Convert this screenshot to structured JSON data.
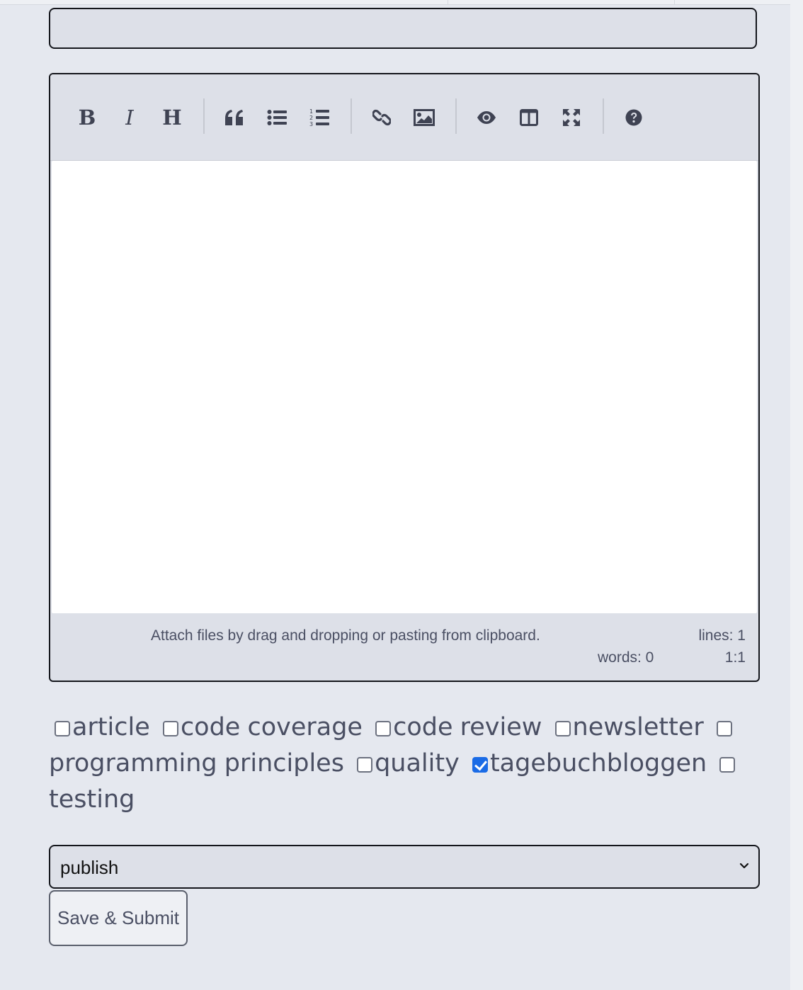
{
  "form": {
    "title_value": "",
    "title_placeholder": ""
  },
  "editor": {
    "toolbar": [
      {
        "name": "bold-icon",
        "glyph": "B"
      },
      {
        "name": "italic-icon",
        "glyph": "I"
      },
      {
        "name": "heading-icon",
        "glyph": "H"
      },
      {
        "name": "quote-icon"
      },
      {
        "name": "unordered-list-icon"
      },
      {
        "name": "ordered-list-icon"
      },
      {
        "name": "link-icon"
      },
      {
        "name": "image-icon"
      },
      {
        "name": "preview-eye-icon"
      },
      {
        "name": "side-by-side-icon"
      },
      {
        "name": "fullscreen-icon"
      },
      {
        "name": "help-icon"
      }
    ],
    "content": "",
    "statusbar": {
      "hint": "Attach files by drag and dropping or pasting from clipboard.",
      "lines": "lines: 1",
      "words": "words: 0",
      "cursor": "1:1"
    }
  },
  "tags": [
    {
      "label": "article",
      "checked": false
    },
    {
      "label": "code coverage",
      "checked": false
    },
    {
      "label": "code review",
      "checked": false
    },
    {
      "label": "newsletter",
      "checked": false
    },
    {
      "label": "programming principles",
      "checked": false
    },
    {
      "label": "quality",
      "checked": false
    },
    {
      "label": "tagebuchbloggen",
      "checked": true
    },
    {
      "label": "testing",
      "checked": false
    }
  ],
  "status_select": {
    "selected": "publish"
  },
  "submit_button": {
    "label": "Save & Submit"
  },
  "colors": {
    "page_bg": "#e5e8ef",
    "field_bg": "#dde0e8",
    "border": "#14161c",
    "text": "#4a4f63",
    "checkbox_checked": "#1a6be6"
  }
}
